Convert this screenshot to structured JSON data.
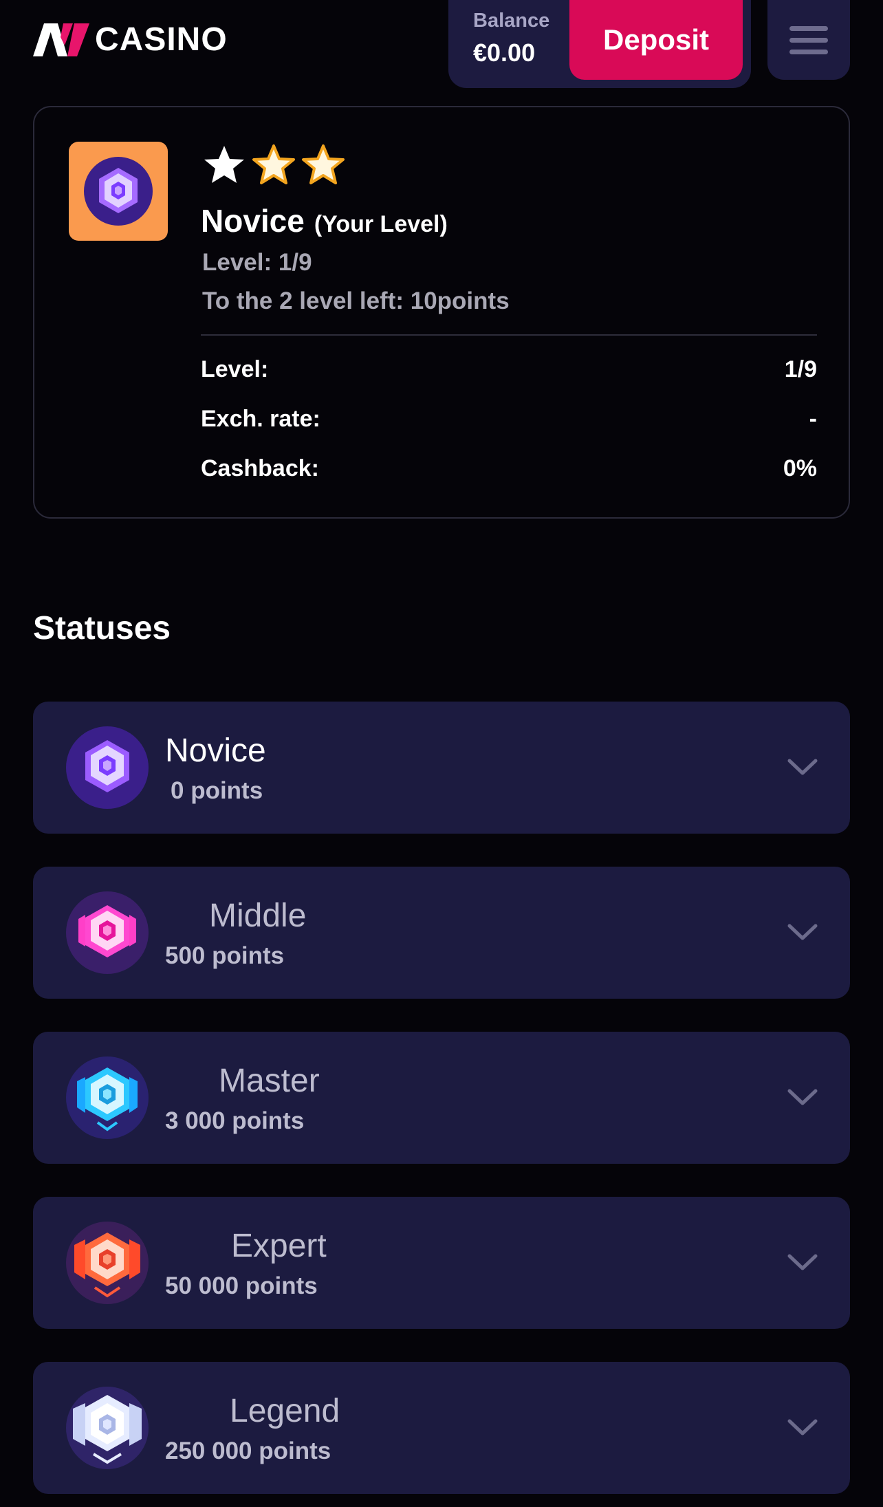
{
  "header": {
    "logo_text": "CASINO",
    "balance_label": "Balance",
    "balance_value": "€0.00",
    "deposit_label": "Deposit"
  },
  "level_card": {
    "stars_filled": 1,
    "stars_total": 3,
    "level_name": "Novice",
    "your_level": "(Your Level)",
    "level_line": "Level: 1/9",
    "next_level_line": "To the 2 level left: 10points",
    "stats": [
      {
        "label": "Level:",
        "value": "1/9"
      },
      {
        "label": "Exch. rate:",
        "value": "-"
      },
      {
        "label": "Cashback:",
        "value": "0%"
      }
    ]
  },
  "statuses": {
    "title": "Statuses",
    "items": [
      {
        "name": "Novice",
        "points": "0 points",
        "icon": "novice-badge-icon",
        "color": "#8a4bff"
      },
      {
        "name": "Middle",
        "points": "500 points",
        "icon": "middle-badge-icon",
        "color": "#ff3fc8"
      },
      {
        "name": "Master",
        "points": "3 000 points",
        "icon": "master-badge-icon",
        "color": "#2cc8ff"
      },
      {
        "name": "Expert",
        "points": "50 000 points",
        "icon": "expert-badge-icon",
        "color": "#ff6a3d"
      },
      {
        "name": "Legend",
        "points": "250 000 points",
        "icon": "legend-badge-icon",
        "color": "#dfe6ff"
      }
    ]
  },
  "colors": {
    "accent": "#d90a57",
    "panel": "#1c1b40",
    "level_icon_bg": "#fa9a4e",
    "star_gold": "#f3a51f"
  }
}
